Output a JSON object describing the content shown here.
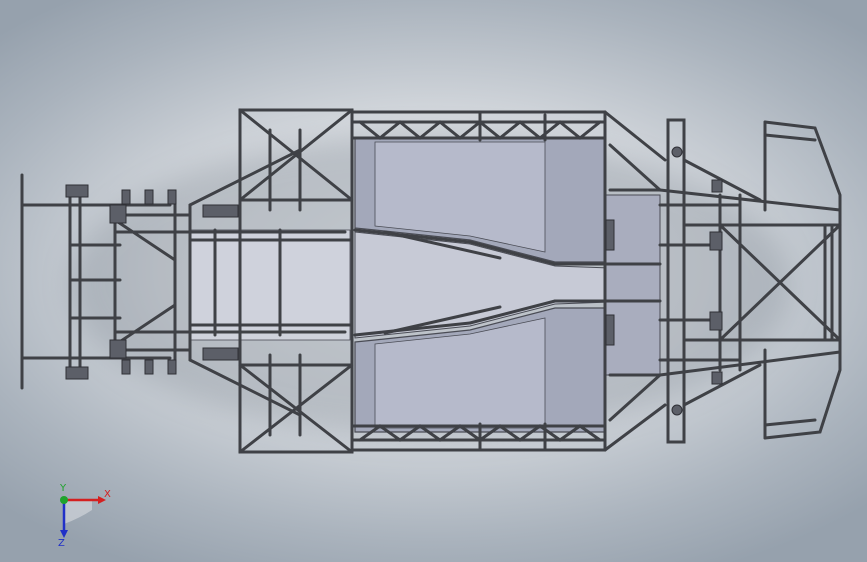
{
  "viewport": {
    "model": "chassis-frame",
    "view": "top"
  },
  "triad": {
    "x_label": "X",
    "y_label": "Y",
    "z_label": "Z",
    "x_color": "#d42020",
    "y_color": "#1fa32c",
    "z_color": "#2030c8"
  },
  "colors": {
    "background_center": "#e9ecef",
    "background_edge": "#96a1ad",
    "tube": "#3f4146",
    "tube_fill": "#8e93a4",
    "floor_panel": "#a3a8ba",
    "floor_panel_light": "#b6bacb",
    "panel_edge": "#4a4c55"
  }
}
